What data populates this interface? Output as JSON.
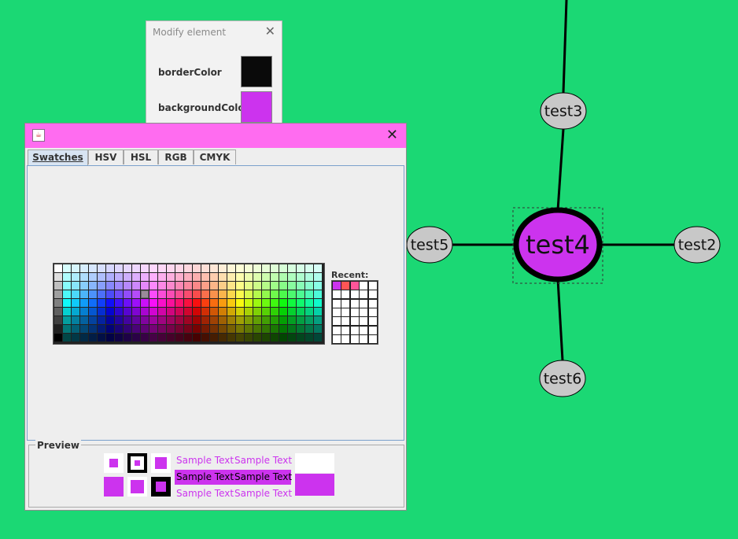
{
  "graph": {
    "line_color": "#000000",
    "nodes": [
      {
        "id": "test3",
        "label": "test3",
        "fill": "#c8c8c8",
        "selected": false
      },
      {
        "id": "test4",
        "label": "test4",
        "fill": "#cc33ee",
        "selected": true
      },
      {
        "id": "test5",
        "label": "test5",
        "fill": "#c8c8c8",
        "selected": false
      },
      {
        "id": "test2",
        "label": "test2",
        "fill": "#c8c8c8",
        "selected": false
      },
      {
        "id": "test6",
        "label": "test6",
        "fill": "#c8c8c8",
        "selected": false
      }
    ]
  },
  "modify_panel": {
    "title": "Modify element",
    "close_icon": "close-icon",
    "rows": [
      {
        "label": "borderColor",
        "color": "#0a0a0a"
      },
      {
        "label": "backgroundColor",
        "color": "#cc33ee"
      }
    ]
  },
  "color_chooser": {
    "titlebar_color": "#ff6cf0",
    "app_icon": "java-icon",
    "close_icon": "close-icon",
    "tabs": [
      {
        "label": "Swatches",
        "active": true
      },
      {
        "label": "HSV",
        "active": false
      },
      {
        "label": "HSL",
        "active": false
      },
      {
        "label": "RGB",
        "active": false
      },
      {
        "label": "CMYK",
        "active": false
      }
    ],
    "recent_label": "Recent:",
    "recent_colors": [
      "#cc33ee",
      "#ff5555",
      "#ff5599"
    ],
    "preview": {
      "title": "Preview",
      "selected_color": "#cc33ee",
      "sample_text": "Sample Text"
    }
  }
}
